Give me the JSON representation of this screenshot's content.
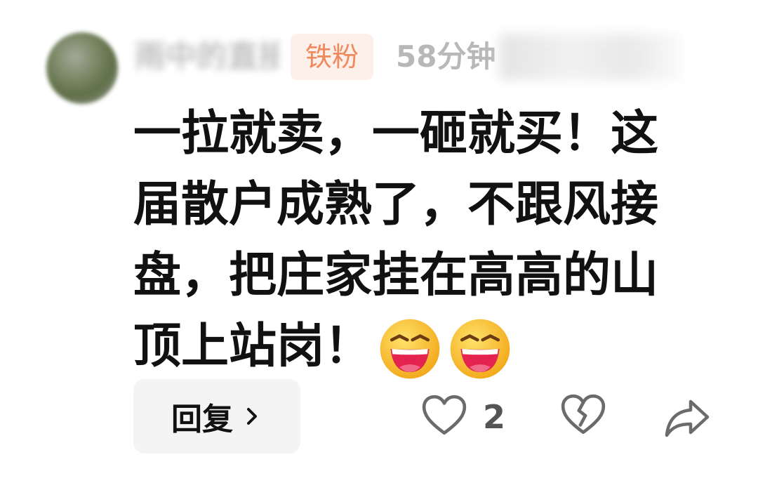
{
  "comment": {
    "username": "雨中的直接",
    "badge": "铁粉",
    "time": "58分钟",
    "body": "一拉就卖，一砸就买！这届散户成熟了，不跟风接盘，把庄家挂在高高的山顶上站岗！",
    "emojis": [
      "laughing-emoji-icon",
      "laughing-emoji-icon"
    ]
  },
  "actions": {
    "reply_label": "回复",
    "like_count": "2",
    "like_icon": "heart-outline-icon",
    "dislike_icon": "broken-heart-icon",
    "share_icon": "share-arrow-icon"
  },
  "colors": {
    "badge_bg": "#fdf0ea",
    "badge_text": "#f08a5d",
    "icon_gray": "#6b6b6b"
  }
}
